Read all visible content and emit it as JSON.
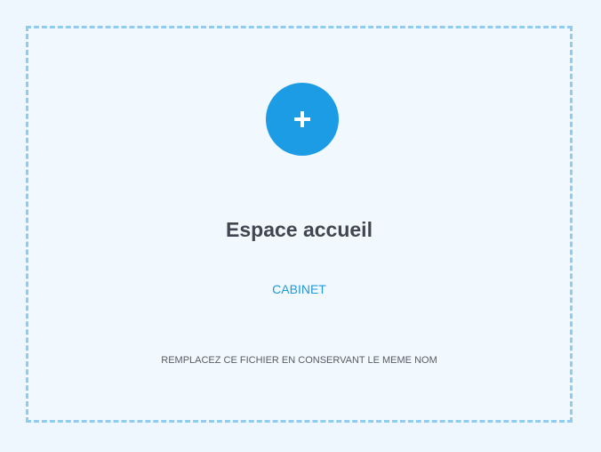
{
  "upload": {
    "icon": "plus-icon",
    "title": "Espace accueil",
    "subtitle": "CABINET",
    "instruction": "REMPLACEZ CE FICHIER EN CONSERVANT LE MEME NOM"
  },
  "colors": {
    "background": "#eef7fd",
    "dropzone_border": "#8fcdef",
    "accent": "#1d9ce6",
    "title": "#414650",
    "subtitle": "#2299d8",
    "instruction": "#575c66"
  }
}
